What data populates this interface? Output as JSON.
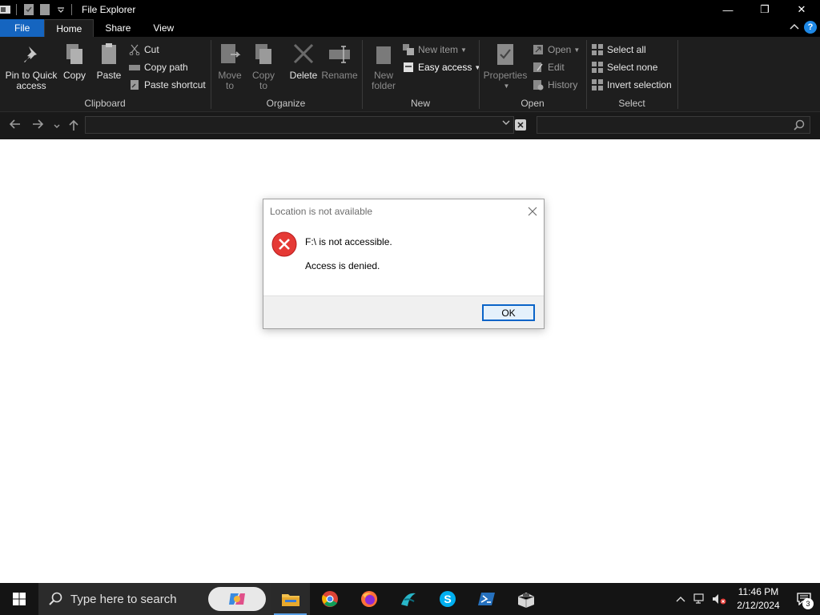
{
  "window": {
    "title": "File Explorer",
    "controls": {
      "minimize": "—",
      "restore": "❐",
      "close": "✕"
    }
  },
  "tabs": {
    "file": "File",
    "home": "Home",
    "share": "Share",
    "view": "View",
    "help": "?"
  },
  "ribbon": {
    "clipboard": {
      "label": "Clipboard",
      "pin": "Pin to Quick access",
      "pin_line1": "Pin to Quick",
      "pin_line2": "access",
      "copy": "Copy",
      "paste": "Paste",
      "cut": "Cut",
      "copy_path": "Copy path",
      "paste_shortcut": "Paste shortcut"
    },
    "organize": {
      "label": "Organize",
      "move_to_1": "Move",
      "move_to_2": "to",
      "copy_to_1": "Copy",
      "copy_to_2": "to",
      "delete": "Delete",
      "rename": "Rename"
    },
    "new": {
      "label": "New",
      "new_folder_1": "New",
      "new_folder_2": "folder",
      "new_item": "New item",
      "easy_access": "Easy access"
    },
    "open": {
      "label": "Open",
      "properties": "Properties",
      "open": "Open",
      "edit": "Edit",
      "history": "History"
    },
    "select": {
      "label": "Select",
      "select_all": "Select all",
      "select_none": "Select none",
      "invert_selection": "Invert selection"
    }
  },
  "address": {
    "path": "",
    "search": ""
  },
  "dialog": {
    "title": "Location is not available",
    "message1": "F:\\ is not accessible.",
    "message2": "Access is denied.",
    "ok": "OK"
  },
  "taskbar": {
    "search_placeholder": "Type here to search",
    "time": "11:46 PM",
    "date": "2/12/2024",
    "notification_count": "3",
    "apps": [
      "file-explorer",
      "chrome",
      "firefox",
      "app-teal",
      "skype",
      "powershell",
      "app-box"
    ]
  },
  "colors": {
    "accent": "#1565c0",
    "ribbon_bg": "#1e1e1e",
    "error_red": "#e53935",
    "ok_border": "#0a64c8"
  }
}
